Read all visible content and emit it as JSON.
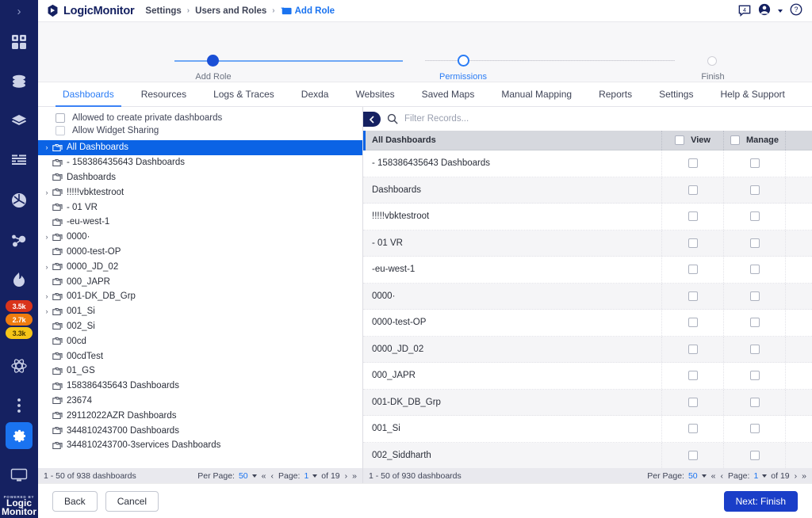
{
  "app": {
    "brand": "LogicMonitor",
    "powered_by_small": "POWERED BY",
    "powered_by_line1": "Logic",
    "powered_by_line2": "Monitor",
    "accent_blue": "#2a7cf5",
    "navy": "#152161",
    "primary_button": "#1a3ec8"
  },
  "breadcrumb": {
    "item1": "Settings",
    "item2": "Users and Roles",
    "item3": "Add Role",
    "separator": "›"
  },
  "topbar": {
    "chat_badge": "4",
    "chat_icon": "chat-icon",
    "account_icon": "account-icon",
    "help_icon": "help-icon"
  },
  "rail": {
    "expand_label": "›",
    "icons": [
      "dashboards-icon",
      "resources-icon",
      "layers-icon",
      "logs-icon",
      "websites-icon",
      "mapping-icon",
      "alerts-icon"
    ],
    "badges": [
      {
        "value": "3.5k",
        "color": "#d9341b"
      },
      {
        "value": "2.7k",
        "color": "#ef7c0e"
      },
      {
        "value": "3.3k",
        "color": "#f5c518"
      }
    ],
    "lower_icons": [
      "atom-icon",
      "more-icon",
      "settings-gear-icon",
      "devices-icon"
    ]
  },
  "stepper": {
    "steps": [
      {
        "label": "Add Role",
        "state": "done"
      },
      {
        "label": "Permissions",
        "state": "current"
      },
      {
        "label": "Finish",
        "state": "todo"
      }
    ]
  },
  "tabs": [
    {
      "label": "Dashboards",
      "active": true
    },
    {
      "label": "Resources",
      "active": false
    },
    {
      "label": "Logs & Traces",
      "active": false
    },
    {
      "label": "Dexda",
      "active": false
    },
    {
      "label": "Websites",
      "active": false
    },
    {
      "label": "Saved Maps",
      "active": false
    },
    {
      "label": "Manual Mapping",
      "active": false
    },
    {
      "label": "Reports",
      "active": false
    },
    {
      "label": "Settings",
      "active": false
    },
    {
      "label": "Help & Support",
      "active": false
    }
  ],
  "options": [
    {
      "label": "Allowed to create private dashboards",
      "checked": false
    },
    {
      "label": "Allow Widget Sharing",
      "checked": false
    }
  ],
  "tree": [
    {
      "label": "All Dashboards",
      "expandable": true,
      "selected": true,
      "indent": 0
    },
    {
      "label": "- 158386435643 Dashboards",
      "expandable": false,
      "selected": false,
      "indent": 1
    },
    {
      "label": "Dashboards",
      "expandable": false,
      "selected": false,
      "indent": 1
    },
    {
      "label": "!!!!!vbktestroot",
      "expandable": true,
      "selected": false,
      "indent": 1
    },
    {
      "label": "- 01 VR",
      "expandable": false,
      "selected": false,
      "indent": 1
    },
    {
      "label": "-eu-west-1",
      "expandable": false,
      "selected": false,
      "indent": 1
    },
    {
      "label": "0000·",
      "expandable": true,
      "selected": false,
      "indent": 1
    },
    {
      "label": "0000-test-OP",
      "expandable": false,
      "selected": false,
      "indent": 1
    },
    {
      "label": "0000_JD_02",
      "expandable": true,
      "selected": false,
      "indent": 1
    },
    {
      "label": "000_JAPR",
      "expandable": false,
      "selected": false,
      "indent": 1
    },
    {
      "label": "001-DK_DB_Grp",
      "expandable": true,
      "selected": false,
      "indent": 1
    },
    {
      "label": "001_Si",
      "expandable": true,
      "selected": false,
      "indent": 1
    },
    {
      "label": "002_Si",
      "expandable": false,
      "selected": false,
      "indent": 1
    },
    {
      "label": "00cd",
      "expandable": false,
      "selected": false,
      "indent": 1
    },
    {
      "label": "00cdTest",
      "expandable": false,
      "selected": false,
      "indent": 1
    },
    {
      "label": "01_GS",
      "expandable": false,
      "selected": false,
      "indent": 1
    },
    {
      "label": "158386435643 Dashboards",
      "expandable": false,
      "selected": false,
      "indent": 1
    },
    {
      "label": "23674",
      "expandable": false,
      "selected": false,
      "indent": 1
    },
    {
      "label": "29112022AZR Dashboards",
      "expandable": false,
      "selected": false,
      "indent": 1
    },
    {
      "label": "344810243700 Dashboards",
      "expandable": false,
      "selected": false,
      "indent": 1
    },
    {
      "label": "344810243700-3services Dashboards",
      "expandable": false,
      "selected": false,
      "indent": 1
    }
  ],
  "tree_pagination": {
    "count": "1 - 50 of 938 dashboards",
    "per_page_label": "Per Page:",
    "per_page_value": "50",
    "first_arrow": "«",
    "prev_arrow": "‹",
    "page_label": "Page:",
    "page_value": "1",
    "of_label": "of 19",
    "next_arrow": "›",
    "last_arrow": "»"
  },
  "search": {
    "placeholder": "Filter Records...",
    "icon": "search-icon",
    "collapse_icon": "collapse-left-icon"
  },
  "table": {
    "columns": {
      "name": "All Dashboards",
      "view": "View",
      "manage": "Manage"
    },
    "rows": [
      {
        "name": "- 158386435643 Dashboards",
        "view": false,
        "manage": false
      },
      {
        "name": "Dashboards",
        "view": false,
        "manage": false
      },
      {
        "name": "!!!!!vbktestroot",
        "view": false,
        "manage": false
      },
      {
        "name": "- 01 VR",
        "view": false,
        "manage": false
      },
      {
        "name": "-eu-west-1",
        "view": false,
        "manage": false
      },
      {
        "name": "0000·",
        "view": false,
        "manage": false
      },
      {
        "name": "0000-test-OP",
        "view": false,
        "manage": false
      },
      {
        "name": "0000_JD_02",
        "view": false,
        "manage": false
      },
      {
        "name": "000_JAPR",
        "view": false,
        "manage": false
      },
      {
        "name": "001-DK_DB_Grp",
        "view": false,
        "manage": false
      },
      {
        "name": "001_Si",
        "view": false,
        "manage": false
      },
      {
        "name": "002_Siddharth",
        "view": false,
        "manage": false
      }
    ]
  },
  "table_pagination": {
    "count": "1 - 50 of 930 dashboards",
    "per_page_label": "Per Page:",
    "per_page_value": "50",
    "first_arrow": "«",
    "prev_arrow": "‹",
    "page_label": "Page:",
    "page_value": "1",
    "of_label": "of 19",
    "next_arrow": "›",
    "last_arrow": "»"
  },
  "footer": {
    "back": "Back",
    "cancel": "Cancel",
    "next": "Next: Finish"
  }
}
